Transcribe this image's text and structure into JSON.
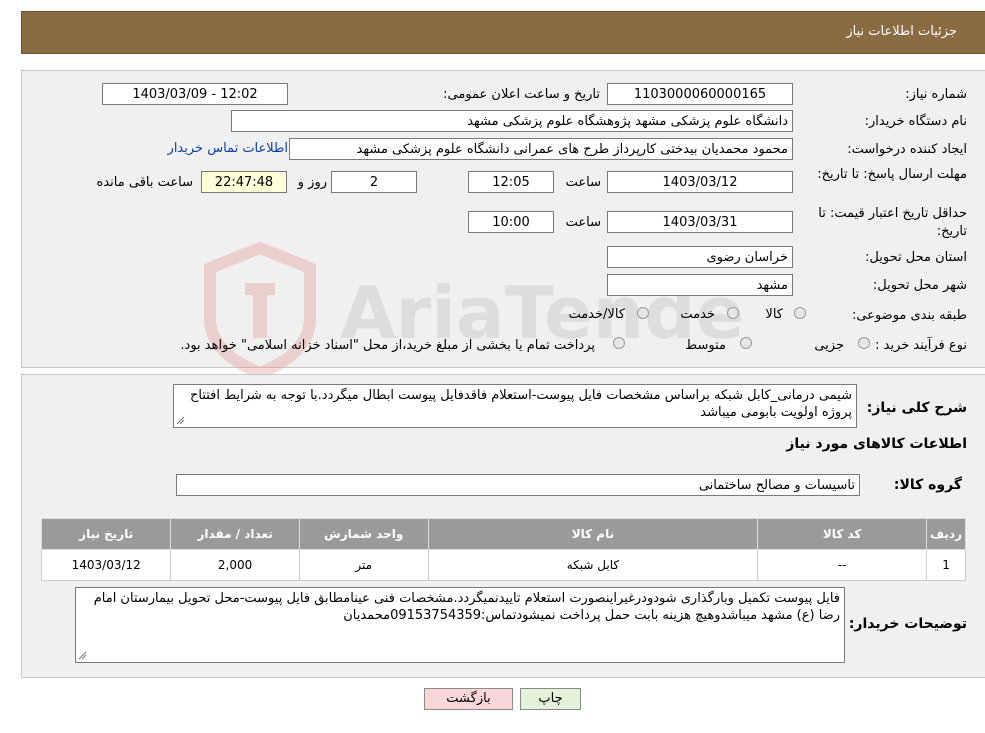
{
  "header": {
    "title": "جزئیات اطلاعات نیاز"
  },
  "form": {
    "need_number_label": "شماره نیاز:",
    "need_number": "1103000060000165",
    "announce_label": "تاریخ و ساعت اعلان عمومی:",
    "announce_value": "1403/03/09 - 12:02",
    "buyer_org_label": "نام دستگاه خریدار:",
    "buyer_org": "دانشگاه علوم پزشکی مشهد   پژوهشگاه علوم پزشکی مشهد",
    "creator_label": "ایجاد کننده درخواست:",
    "creator": "محمود محمدیان بیدختی کارپرداز طرح های عمرانی دانشگاه علوم پزشکی مشهد",
    "contact_link": "اطلاعات تماس خریدار",
    "deadline_label": "مهلت ارسال پاسخ: تا تاریخ:",
    "deadline_date": "1403/03/12",
    "time_label": "ساعت",
    "deadline_time": "12:05",
    "days_value": "2",
    "days_label": "روز و",
    "remaining_time": "22:47:48",
    "remaining_label": "ساعت باقی مانده",
    "validity_label": "حداقل تاریخ اعتبار قیمت: تا تاریخ:",
    "validity_date": "1403/03/31",
    "validity_time": "10:00",
    "province_label": "استان محل تحویل:",
    "province": "خراسان رضوی",
    "city_label": "شهر محل تحویل:",
    "city": "مشهد",
    "category_label": "طبقه بندی موضوعی:",
    "category_options": [
      "کالا",
      "خدمت",
      "کالا/خدمت"
    ],
    "process_label": "نوع فرآیند خرید :",
    "process_options": [
      "جزیی",
      "متوسط"
    ],
    "process_note": "پرداخت تمام یا بخشی از مبلغ خرید،از محل \"اسناد خزانه اسلامی\" خواهد بود."
  },
  "details": {
    "summary_label": "شرح کلی نیاز:",
    "summary": "شیمی درمانی_کابل شبکه براساس مشخصات فایل پیوست-استعلام فاقدفایل پیوست ابطال میگردد.با توجه به شرایط افتتاح پروژه اولویت بابومی میباشد",
    "items_title": "اطلاعات کالاهای مورد نیاز",
    "group_label": "گروه کالا:",
    "group_value": "تاسیسات و مصالح ساختمانی",
    "table": {
      "headers": [
        "ردیف",
        "کد کالا",
        "نام کالا",
        "واحد شمارش",
        "تعداد / مقدار",
        "تاریخ نیاز"
      ],
      "rows": [
        [
          "1",
          "--",
          "کابل شبکه",
          "متر",
          "2,000",
          "1403/03/12"
        ]
      ]
    },
    "buyer_notes_label": "توضیحات خریدار:",
    "buyer_notes": "فایل پیوست تکمیل وبارگذاری شودودرغیراینصورت استعلام تاییدنمیگردد.مشخصات فنی عینامطابق فایل پیوست-محل تحویل بیمارستان امام رضا (ع) مشهد میباشدوهیچ هزینه بابت حمل پرداخت نمیشودتماس:09153754359محمدیان"
  },
  "buttons": {
    "print": "چاپ",
    "back": "بازگشت"
  },
  "watermark": {
    "text": "AriaTender.neT"
  },
  "colors": {
    "header_bg": "#8B6B41",
    "link": "#0b41a8",
    "back_bg": "#f9d7d7",
    "print_bg": "#e2f3d9"
  }
}
